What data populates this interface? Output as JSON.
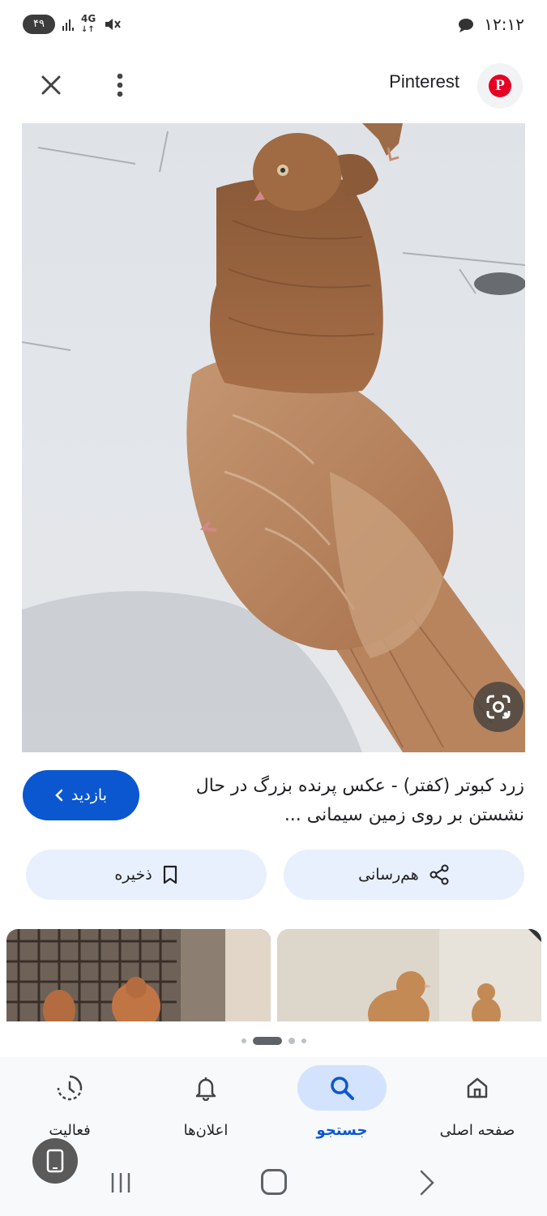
{
  "status_bar": {
    "time": "۱۲:۱۲",
    "battery": "۴۹",
    "network": "4G"
  },
  "header": {
    "site_name": "Pinterest",
    "logo_letter": "P"
  },
  "result": {
    "caption_line1": "زرد کبوتر (کفتر) - عکس پرنده بزرگ در حال",
    "caption_line2": "نشستن بر روی زمین سیمانی ...",
    "visit_label": "بازدید",
    "share_label": "هم‌رسانی",
    "save_label": "ذخیره"
  },
  "pager": {
    "count": 4,
    "active_index": 1
  },
  "bottom_nav": {
    "items": [
      {
        "label": "صفحه اصلی",
        "icon": "home-icon"
      },
      {
        "label": "جستجو",
        "icon": "search-icon",
        "active": true
      },
      {
        "label": "اعلان‌ها",
        "icon": "bell-icon"
      },
      {
        "label": "فعالیت",
        "icon": "activity-icon"
      }
    ]
  },
  "colors": {
    "accent": "#0b57d0",
    "chip_bg": "#e8f0fe",
    "pinterest_red": "#e60023"
  }
}
